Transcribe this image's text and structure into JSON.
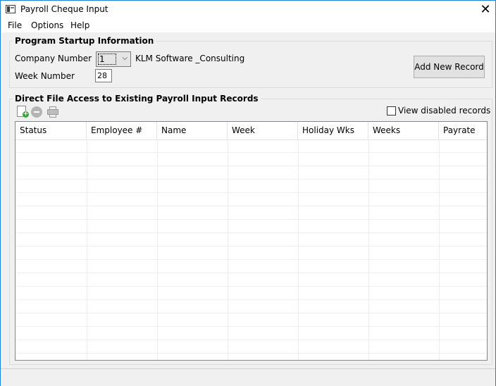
{
  "window": {
    "title": "Payroll Cheque Input",
    "close_glyph": "✕"
  },
  "menu": {
    "file": "File",
    "options": "Options",
    "help": "Help"
  },
  "startup": {
    "group_title": "Program Startup Information",
    "company_label": "Company Number",
    "company_value": "1",
    "company_name": "KLM Software _Consulting",
    "week_label": "Week Number",
    "week_value": "28",
    "add_button": "Add New Record"
  },
  "records": {
    "group_title": "Direct File Access to Existing Payroll Input Records",
    "view_disabled_label": "View disabled records",
    "view_disabled_checked": false,
    "columns": [
      "Status",
      "Employee #",
      "Name",
      "Week",
      "Holiday Wks",
      "Weeks",
      "Payrate"
    ],
    "rows": []
  },
  "icons": [
    "window-app-icon",
    "close-icon",
    "new-record-icon",
    "remove-record-icon",
    "print-icon",
    "dropdown-arrow-icon"
  ]
}
